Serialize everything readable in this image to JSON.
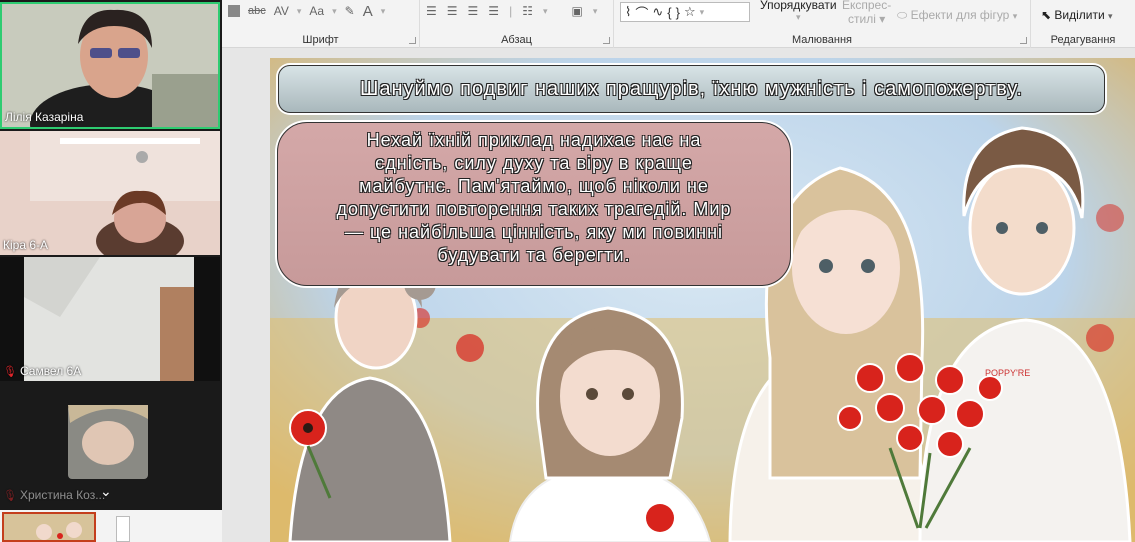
{
  "ribbon": {
    "groups": {
      "font": "Шрифт",
      "paragraph": "Абзац",
      "drawing": "Малювання",
      "editing": "Редагування"
    },
    "font_tools": {
      "strike": "abc",
      "spacing": "AV",
      "case": "Aa",
      "color": "A"
    },
    "arrange_label": "Упорядкувати",
    "quick_styles_label_1": "Експрес-",
    "quick_styles_label_2": "стилі",
    "shape_effects_label": "Ефекти для фігур",
    "select_label": "Виділити"
  },
  "participants": [
    {
      "name": "Лілія Казаріна",
      "muted": false,
      "active": true
    },
    {
      "name": "Кіра 6-А",
      "muted": false,
      "active": false
    },
    {
      "name": "Самвел 6А",
      "muted": true,
      "active": false
    },
    {
      "name": "Христина Коз...",
      "muted": true,
      "active": false
    }
  ],
  "slide": {
    "banner_text": "Шануймо подвиг наших пращурів, їхню мужність і самопожертву.",
    "bubble_lines": [
      "Нехай їхній приклад надихає нас на",
      "єдність, силу духу та віру в краще",
      "майбутнє. Пам'ятаймо, щоб ніколи не",
      "допустити повторення таких трагедій. Мир",
      "— це найбільша цінність, яку ми повинні",
      "будувати та берегти."
    ],
    "shirt_text": "POPPY'RE"
  },
  "colors": {
    "active_speaker": "#2ecc71",
    "poppy": "#d8231c",
    "thumb_border": "#c43e1c"
  }
}
